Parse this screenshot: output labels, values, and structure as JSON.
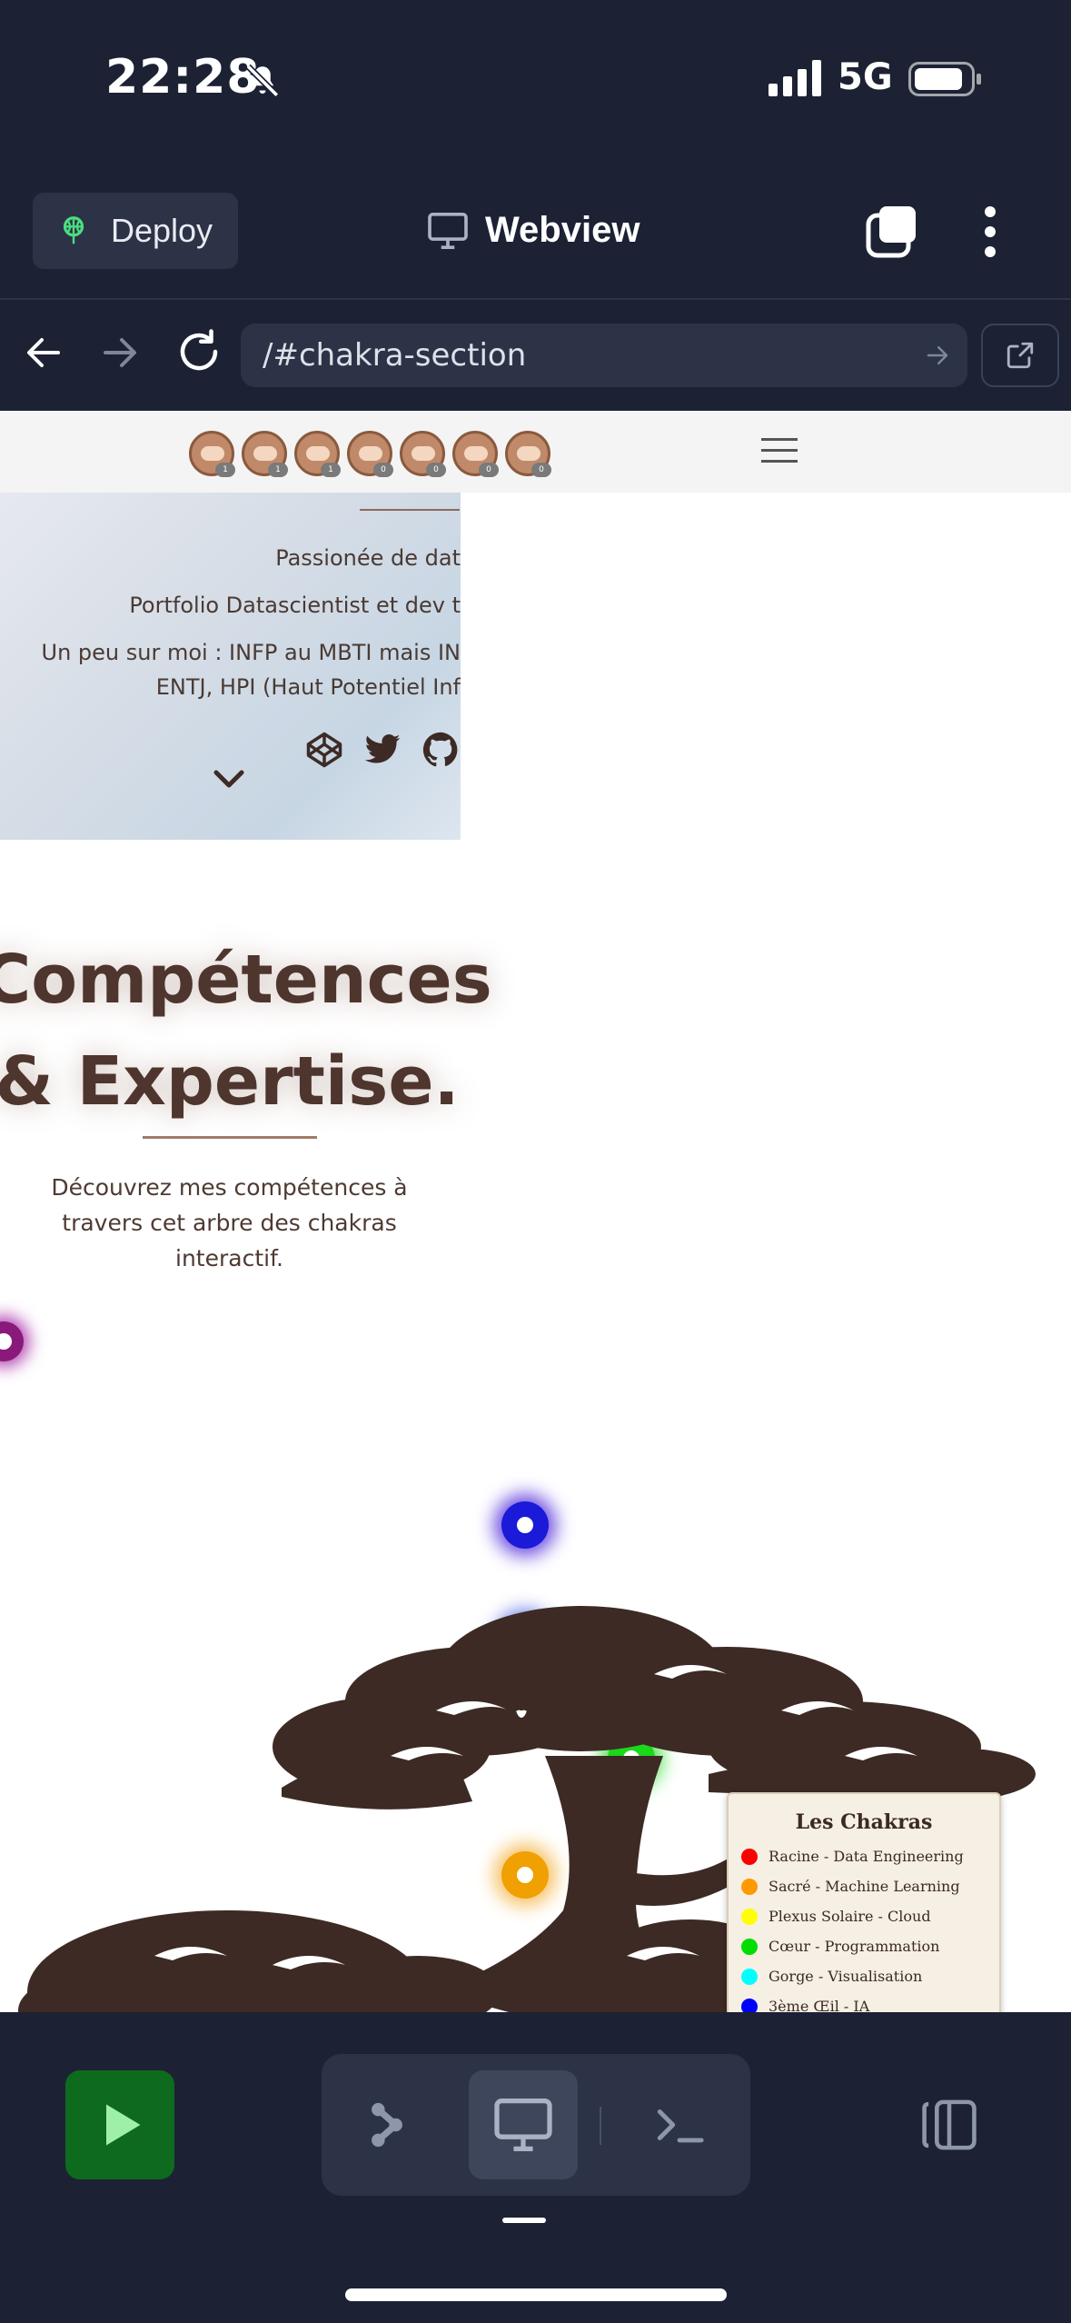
{
  "status_bar": {
    "time": "22:28",
    "network": "5G"
  },
  "top_bar": {
    "deploy_label": "Deploy",
    "title": "Webview"
  },
  "address_bar": {
    "url": "/#chakra-section"
  },
  "site": {
    "avatar_badges": [
      "1",
      "1",
      "1",
      "0",
      "0",
      "0",
      "0"
    ],
    "hero": {
      "tagline": "Passionée de dat",
      "subtitle": "Portfolio Datascientist et dev t",
      "about_line1": "Un peu sur moi : INFP au MBTI mais IN",
      "about_line2": "ENTJ, HPI (Haut Potentiel Inf"
    },
    "section": {
      "title_line1": "Compétences",
      "title_line2": "& Expertise.",
      "description": "Découvrez mes compétences à travers cet arbre des chakras interactif."
    },
    "legend": {
      "title": "Les Chakras",
      "items": [
        {
          "label": "Racine - Data Engineering",
          "color": "#ff0000"
        },
        {
          "label": "Sacré - Machine Learning",
          "color": "#ff9900"
        },
        {
          "label": "Plexus Solaire - Cloud",
          "color": "#ffff00"
        },
        {
          "label": "Cœur - Programmation",
          "color": "#00dd00"
        },
        {
          "label": "Gorge - Visualisation",
          "color": "#00ffff"
        },
        {
          "label": "3ème Œil - IA",
          "color": "#0000ff"
        }
      ]
    }
  },
  "colors": {
    "background": "#1c2234",
    "panel": "#2c3346",
    "run_button": "#0e6b1e",
    "tree": "#3d2a24"
  }
}
